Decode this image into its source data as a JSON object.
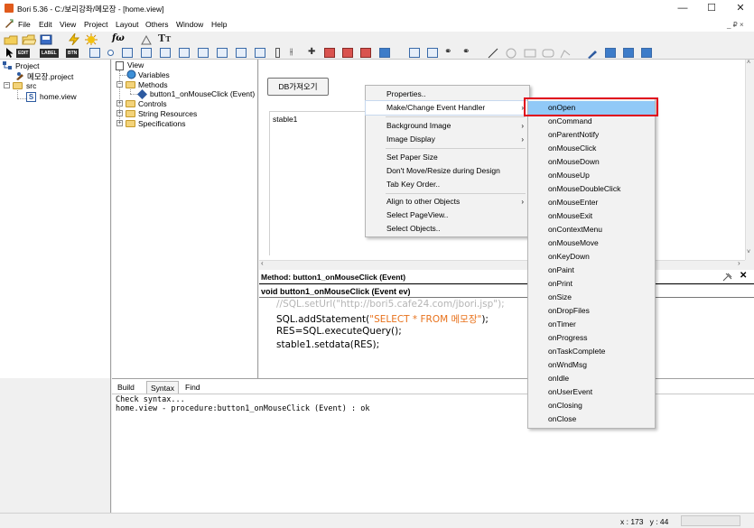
{
  "window": {
    "title": "Bori 5.36 - C:/보리강좌/메모장 - [home.view]",
    "controls": [
      "—",
      "☐",
      "✕"
    ]
  },
  "menubar": {
    "items": [
      "File",
      "Edit",
      "View",
      "Project",
      "Layout",
      "Others",
      "Window",
      "Help"
    ],
    "mdi_controls": "_ ₽ ×"
  },
  "toolbar2_labels": [
    "EDIT",
    "LABEL",
    "BTN"
  ],
  "toolbar_italic_text": "fω",
  "project_tree": {
    "root": "Project",
    "project_file": "메모장.project",
    "src": "src",
    "view_file": "home.view"
  },
  "object_tree": {
    "root": "View",
    "items": [
      "Variables",
      "Methods",
      "button1_onMouseClick (Event)",
      "Controls",
      "String Resources",
      "Specifications"
    ]
  },
  "design": {
    "button_label": "DB가져오기",
    "table_label": "stable1"
  },
  "method_editor": {
    "header": "Method: button1_onMouseClick (Event)",
    "signature": "void button1_onMouseClick (Event ev)",
    "code_line1": "//SQL.setUrl(\"http://bori5.cafe24.com/jbori.jsp\");",
    "code_line2_a": "SQL.addStatement(",
    "code_line2_b": "\"SELECT * FROM 메모장\"",
    "code_line2_c": ");",
    "code_line3": "RES=SQL.executeQuery();",
    "code_line4": "stable1.setdata(RES);",
    "close_symbol": "✕"
  },
  "output": {
    "tabs": [
      "Build",
      "Syntax",
      "Find"
    ],
    "active_tab": "Syntax",
    "line1": "Check syntax...",
    "line2": "home.view - procedure:button1_onMouseClick (Event) : ok"
  },
  "context_menu": {
    "items": [
      "Properties..",
      "Make/Change Event Handler",
      "Background Image",
      "Image Display",
      "Set Paper Size",
      "Don't Move/Resize during Design",
      "Tab Key Order..",
      "Align to other Objects",
      "Select PageView..",
      "Select Objects.."
    ],
    "arrow": "›"
  },
  "submenu": {
    "items": [
      "onOpen",
      "onCommand",
      "onParentNotify",
      "onMouseClick",
      "onMouseDown",
      "onMouseUp",
      "onMouseDoubleClick",
      "onMouseEnter",
      "onMouseExit",
      "onContextMenu",
      "onMouseMove",
      "onKeyDown",
      "onPaint",
      "onPrint",
      "onSize",
      "onDropFiles",
      "onTimer",
      "onProgress",
      "onTaskComplete",
      "onWndMsg",
      "onIdle",
      "onUserEvent",
      "onClosing",
      "onClose"
    ],
    "selected": "onOpen"
  },
  "statusbar": {
    "coords": "x : 173   y : 44"
  },
  "colors": {
    "accent_red": "#e0001b",
    "selection_blue": "#91c9f7",
    "string_orange": "#e8721c"
  }
}
